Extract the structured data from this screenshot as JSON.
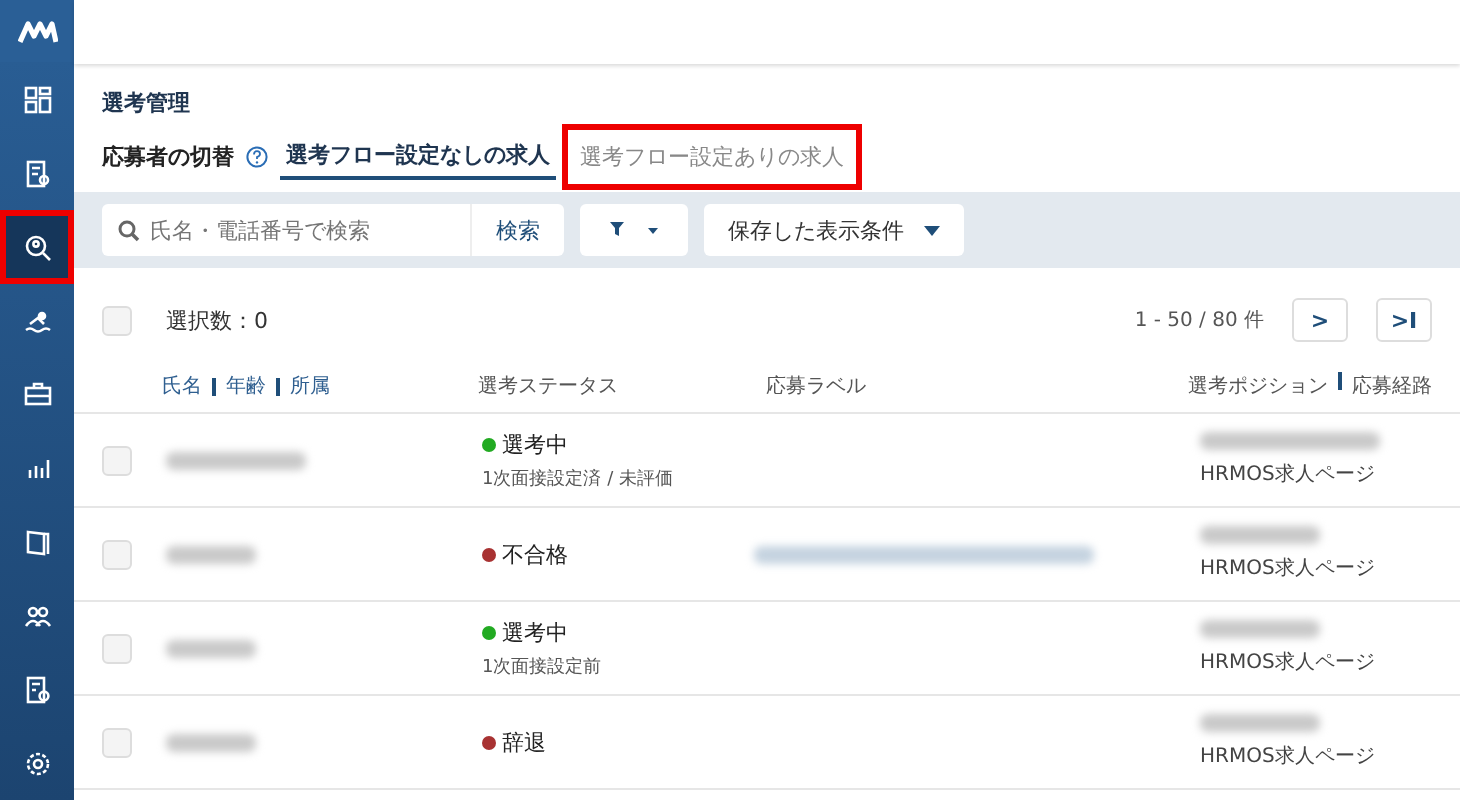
{
  "sidebar": {
    "items": [
      {
        "selected": false,
        "highlighted": false
      },
      {
        "selected": false,
        "highlighted": false
      },
      {
        "selected": true,
        "highlighted": true
      },
      {
        "selected": false,
        "highlighted": false
      },
      {
        "selected": false,
        "highlighted": false
      },
      {
        "selected": false,
        "highlighted": false
      },
      {
        "selected": false,
        "highlighted": false
      },
      {
        "selected": false,
        "highlighted": false
      },
      {
        "selected": false,
        "highlighted": false
      },
      {
        "selected": false,
        "highlighted": false
      }
    ]
  },
  "page_title": "選考管理",
  "switch_label": "応募者の切替",
  "tabs": [
    {
      "label": "選考フロー設定なしの求人",
      "selected": true,
      "highlighted": false
    },
    {
      "label": "選考フロー設定ありの求人",
      "selected": false,
      "highlighted": true
    }
  ],
  "search": {
    "placeholder": "氏名・電話番号で検索",
    "button": "検索"
  },
  "saved_filter": "保存した表示条件",
  "selection": {
    "checked": false,
    "label": "選択数：0"
  },
  "pagination": {
    "range": "1 - 50 / 80 件",
    "next": ">",
    "last": ">I"
  },
  "columns": {
    "name": [
      "氏名",
      "年齢",
      "所属"
    ],
    "status": "選考ステータス",
    "label": "応募ラベル",
    "position": [
      "選考ポジション",
      "応募経路"
    ]
  },
  "rows": [
    {
      "checked": false,
      "status": "選考中",
      "color": "#22aa22",
      "substatus": "1次面接設定済 / 未評価",
      "label_redacted": false,
      "source": "HRMOS求人ページ"
    },
    {
      "checked": false,
      "status": "不合格",
      "color": "#a83232",
      "label_redacted": true,
      "source": "HRMOS求人ページ"
    },
    {
      "checked": false,
      "status": "選考中",
      "color": "#22aa22",
      "substatus": "1次面接設定前",
      "label_redacted": false,
      "source": "HRMOS求人ページ"
    },
    {
      "checked": false,
      "status": "辞退",
      "color": "#a83232",
      "label_redacted": false,
      "source": "HRMOS求人ページ"
    }
  ]
}
